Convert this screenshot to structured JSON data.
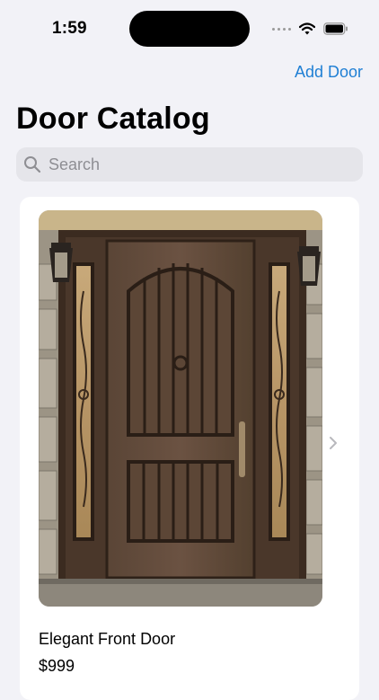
{
  "status": {
    "time": "1:59"
  },
  "nav": {
    "add_label": "Add Door"
  },
  "page": {
    "title": "Door Catalog"
  },
  "search": {
    "placeholder": "Search",
    "value": ""
  },
  "doors": [
    {
      "name": "Elegant Front Door",
      "price": "$999"
    }
  ],
  "icons": {
    "search": "magnifying-glass",
    "disclosure": "chevron-right",
    "wifi": "wifi",
    "battery": "battery-full",
    "cellular": "cellular-dots"
  },
  "colors": {
    "accent": "#1f7fd4",
    "background": "#f2f2f7",
    "search_fill": "#e5e5ea"
  }
}
